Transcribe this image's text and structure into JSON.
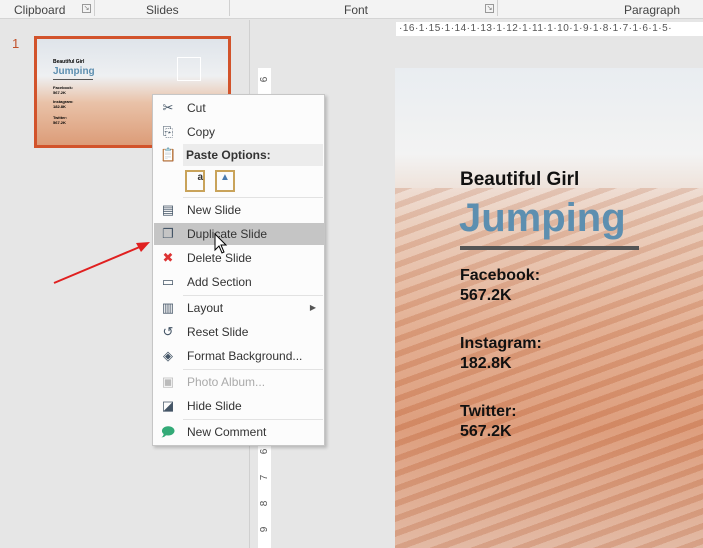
{
  "ribbon": {
    "groups": [
      "Clipboard",
      "Slides",
      "Font",
      "Paragraph"
    ]
  },
  "thumbnail": {
    "number": "1",
    "title": "Beautiful Girl",
    "headline": "Jumping",
    "lines": [
      "Facebook:",
      "567.2K",
      "Instagram:",
      "182.8K",
      "Twitter:",
      "567.2K"
    ]
  },
  "ruler": {
    "horizontal": "·16·1·15·1·14·1·13·1·12·1·11·1·10·1·9·1·8·1·7·1·6·1·5·",
    "vertical_top": "6",
    "vertical_bottom": [
      "6",
      "7",
      "8",
      "9"
    ]
  },
  "slide": {
    "title": "Beautiful Girl",
    "headline": "Jumping",
    "facebook_label": "Facebook:",
    "facebook_value": "567.2K",
    "instagram_label": "Instagram:",
    "instagram_value": "182.8K",
    "twitter_label": "Twitter:",
    "twitter_value": "567.2K"
  },
  "menu": {
    "items": [
      {
        "label": "Cut",
        "icon": "scissors-icon"
      },
      {
        "label": "Copy",
        "icon": "copy-icon"
      },
      {
        "label": "Paste Options:",
        "icon": "paste-icon"
      },
      {
        "label": "New Slide",
        "icon": "new-slide-icon"
      },
      {
        "label": "Duplicate Slide",
        "icon": "duplicate-slide-icon"
      },
      {
        "label": "Delete Slide",
        "icon": "delete-slide-icon"
      },
      {
        "label": "Add Section",
        "icon": "add-section-icon"
      },
      {
        "label": "Layout",
        "icon": "layout-icon"
      },
      {
        "label": "Reset Slide",
        "icon": "reset-slide-icon"
      },
      {
        "label": "Format Background...",
        "icon": "format-background-icon"
      },
      {
        "label": "Photo Album...",
        "icon": "photo-album-icon"
      },
      {
        "label": "Hide Slide",
        "icon": "hide-slide-icon"
      },
      {
        "label": "New Comment",
        "icon": "new-comment-icon"
      }
    ]
  },
  "colors": {
    "accent": "#d2532b",
    "headline": "#5d8fb0",
    "highlight": "#c5c5c5",
    "arrow": "#e02020"
  }
}
